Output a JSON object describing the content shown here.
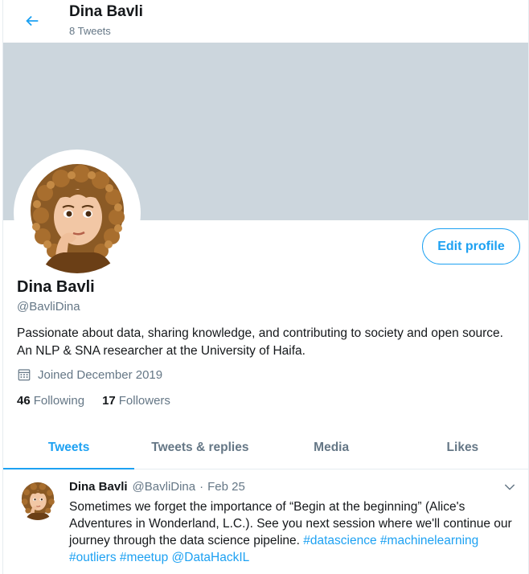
{
  "header": {
    "name": "Dina Bavli",
    "tweet_count": "8 Tweets"
  },
  "profile": {
    "name": "Dina Bavli",
    "handle": "@BavliDina",
    "bio": "Passionate about data, sharing knowledge, and contributing to society and open source. An NLP & SNA researcher at the University of Haifa.",
    "joined": "Joined December 2019",
    "edit_button": "Edit profile",
    "following_count": "46",
    "following_label": "Following",
    "followers_count": "17",
    "followers_label": "Followers"
  },
  "tabs": [
    {
      "label": "Tweets",
      "active": true
    },
    {
      "label": "Tweets & replies",
      "active": false
    },
    {
      "label": "Media",
      "active": false
    },
    {
      "label": "Likes",
      "active": false
    }
  ],
  "tweet": {
    "name": "Dina Bavli",
    "handle": "@BavliDina",
    "dot": "·",
    "date": "Feb 25",
    "text_1": "Sometimes we forget the importance of “Begin at the beginning” (Alice's Adventures in Wonderland, L.C.). See you next session where we'll continue our journey through the data science pipeline. ",
    "hashtag_1": "#datascience",
    "hashtag_2": "#machinelearning",
    "hashtag_3": "#outliers",
    "hashtag_4": "#meetup",
    "mention_1": "@DataHackIL"
  },
  "icons": {
    "back": "arrow-left-icon",
    "calendar": "calendar-icon",
    "caret": "chevron-down-icon"
  },
  "colors": {
    "accent": "#1da1f2",
    "banner": "#ccd6dd",
    "secondary_text": "#657786",
    "primary_text": "#14171a"
  }
}
